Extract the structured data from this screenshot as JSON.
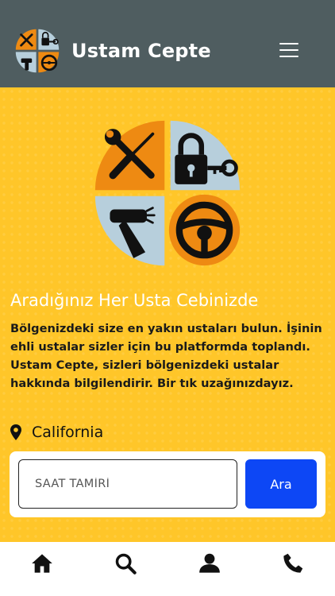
{
  "header": {
    "title": "Ustam Cepte",
    "menu_icon": "hamburger-menu-icon",
    "logo": "ustam-cepte-logo"
  },
  "hero": {
    "tagline": "Aradığınız Her Usta Cebinizde",
    "description": "Bölgenizdeki size en yakın ustaları bulun. İşinin ehli ustalar sizler için bu platformda toplandı. Ustam Cepte, sizleri bölgenizdeki ustalar hakkında bilgilendirir. Bir tık uzağınızdayız.",
    "location": "California",
    "location_icon": "map-pin-icon"
  },
  "search": {
    "placeholder": "SAAT TAMİRİ",
    "button_label": "Ara"
  },
  "bottom_nav": {
    "items": [
      {
        "icon": "home-icon"
      },
      {
        "icon": "search-icon"
      },
      {
        "icon": "user-icon"
      },
      {
        "icon": "phone-icon"
      }
    ]
  },
  "colors": {
    "header_bg": "#4f5d60",
    "hero_bg": "#ffc629",
    "primary_button": "#0d47f5",
    "logo_orange": "#ee8a12",
    "logo_blue": "#b7cfdc"
  }
}
